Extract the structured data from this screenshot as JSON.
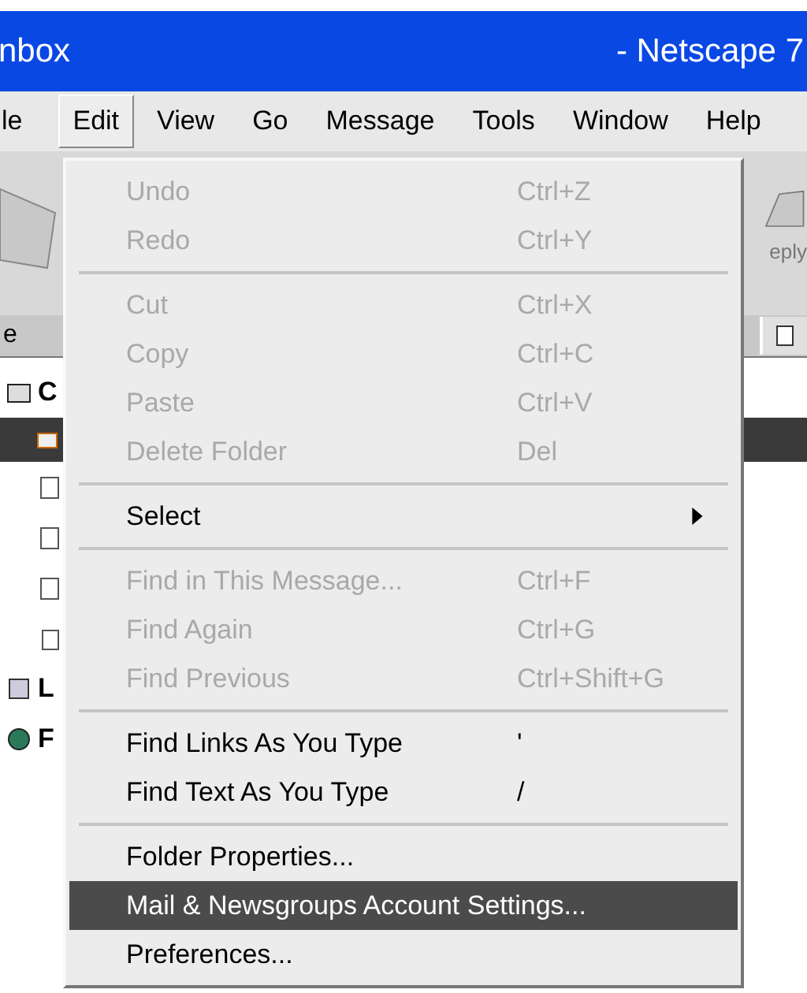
{
  "window": {
    "title": "nbox",
    "title_suffix": "- Netscape 7"
  },
  "menubar": [
    {
      "label": "le",
      "selected": false
    },
    {
      "label": "Edit",
      "selected": true
    },
    {
      "label": "View",
      "selected": false
    },
    {
      "label": "Go",
      "selected": false
    },
    {
      "label": "Message",
      "selected": false
    },
    {
      "label": "Tools",
      "selected": false
    },
    {
      "label": "Window",
      "selected": false
    },
    {
      "label": "Help",
      "selected": false
    }
  ],
  "background": {
    "left_labels": [
      "e",
      "C",
      "L",
      "F"
    ],
    "toolbar_label": "eply"
  },
  "edit_menu": [
    {
      "kind": "item",
      "label": "Undo",
      "shortcut": "Ctrl+Z",
      "disabled": true,
      "selected": false
    },
    {
      "kind": "item",
      "label": "Redo",
      "shortcut": "Ctrl+Y",
      "disabled": true,
      "selected": false
    },
    {
      "kind": "separator"
    },
    {
      "kind": "item",
      "label": "Cut",
      "shortcut": "Ctrl+X",
      "disabled": true,
      "selected": false
    },
    {
      "kind": "item",
      "label": "Copy",
      "shortcut": "Ctrl+C",
      "disabled": true,
      "selected": false
    },
    {
      "kind": "item",
      "label": "Paste",
      "shortcut": "Ctrl+V",
      "disabled": true,
      "selected": false
    },
    {
      "kind": "item",
      "label": "Delete Folder",
      "shortcut": "Del",
      "disabled": true,
      "selected": false
    },
    {
      "kind": "separator"
    },
    {
      "kind": "submenu",
      "label": "Select",
      "disabled": false,
      "selected": false
    },
    {
      "kind": "separator"
    },
    {
      "kind": "item",
      "label": "Find in This Message...",
      "shortcut": "Ctrl+F",
      "disabled": true,
      "selected": false
    },
    {
      "kind": "item",
      "label": "Find Again",
      "shortcut": "Ctrl+G",
      "disabled": true,
      "selected": false
    },
    {
      "kind": "item",
      "label": "Find Previous",
      "shortcut": "Ctrl+Shift+G",
      "disabled": true,
      "selected": false
    },
    {
      "kind": "separator"
    },
    {
      "kind": "item",
      "label": "Find Links As You Type",
      "shortcut": "'",
      "disabled": false,
      "selected": false
    },
    {
      "kind": "item",
      "label": "Find Text As You Type",
      "shortcut": "/",
      "disabled": false,
      "selected": false
    },
    {
      "kind": "separator"
    },
    {
      "kind": "item",
      "label": "Folder Properties...",
      "disabled": false,
      "selected": false
    },
    {
      "kind": "item",
      "label": "Mail & Newsgroups Account Settings...",
      "disabled": false,
      "selected": true
    },
    {
      "kind": "item",
      "label": "Preferences...",
      "disabled": false,
      "selected": false
    }
  ]
}
